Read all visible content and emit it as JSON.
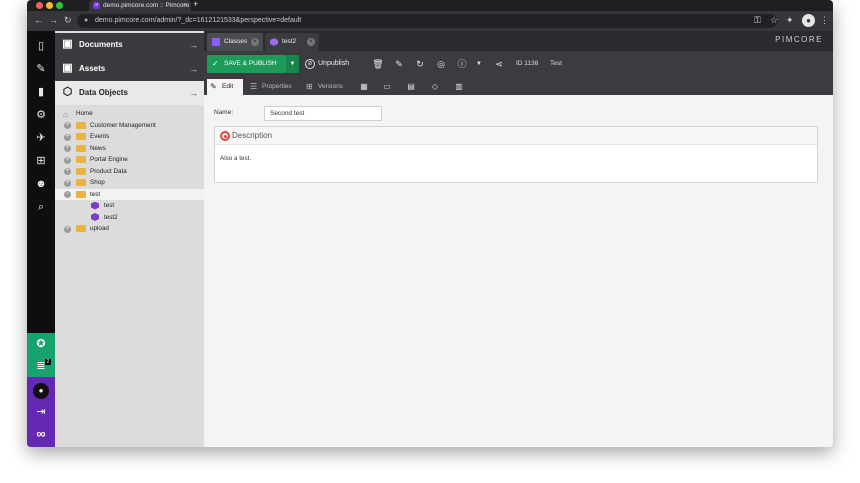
{
  "browser": {
    "tab_title": "demo.pimcore.com :: Pimcore",
    "tab_favicon": "∞",
    "url": "demo.pimcore.com/admin/?_dc=1612121533&perspective=default"
  },
  "sidebar": {
    "chat_badge": "2"
  },
  "tree_panel": {
    "sections": [
      {
        "label": "Documents",
        "icon": "document-icon"
      },
      {
        "label": "Assets",
        "icon": "image-icon"
      },
      {
        "label": "Data Objects",
        "icon": "cube-icon"
      }
    ],
    "nodes": [
      {
        "label": "Home"
      },
      {
        "label": "Customer Management"
      },
      {
        "label": "Events"
      },
      {
        "label": "News"
      },
      {
        "label": "Portal Engine"
      },
      {
        "label": "Product Data"
      },
      {
        "label": "Shop"
      },
      {
        "label": "test"
      },
      {
        "label": "test"
      },
      {
        "label": "test2"
      },
      {
        "label": "upload"
      }
    ]
  },
  "editor": {
    "tabs": [
      {
        "label": "Classes"
      },
      {
        "label": "test2"
      }
    ],
    "brand": "PIMCORE",
    "toolbar": {
      "save_label": "SAVE & PUBLISH",
      "unpublish_label": "Unpublish",
      "id_label": "ID 1136",
      "type_label": "Test"
    },
    "subtabs": [
      {
        "label": "Edit"
      },
      {
        "label": "Properties"
      },
      {
        "label": "Versions"
      }
    ],
    "form": {
      "name_label": "Name:",
      "name_value": "Second test",
      "panel_title": "Description",
      "panel_text": "Also a test."
    }
  },
  "colors": {
    "accent_green": "#1e9b5a",
    "accent_purple": "#6428b4",
    "folder_yellow": "#e8b340"
  }
}
